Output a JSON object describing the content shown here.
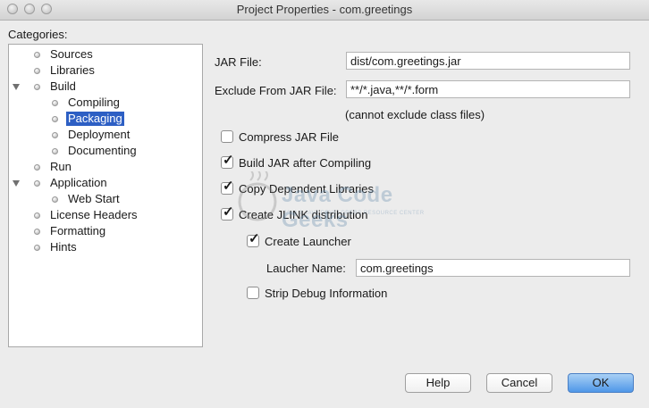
{
  "window": {
    "title": "Project Properties - com.greetings"
  },
  "categories": {
    "label": "Categories:",
    "items": [
      {
        "label": "Sources"
      },
      {
        "label": "Libraries"
      },
      {
        "label": "Build"
      },
      {
        "label": "Compiling"
      },
      {
        "label": "Packaging",
        "selected": true
      },
      {
        "label": "Deployment"
      },
      {
        "label": "Documenting"
      },
      {
        "label": "Run"
      },
      {
        "label": "Application"
      },
      {
        "label": "Web Start"
      },
      {
        "label": "License Headers"
      },
      {
        "label": "Formatting"
      },
      {
        "label": "Hints"
      }
    ]
  },
  "form": {
    "jar_file_label": "JAR File:",
    "jar_file_value": "dist/com.greetings.jar",
    "exclude_label": "Exclude From JAR File:",
    "exclude_value": "**/*.java,**/*.form",
    "exclude_note": "(cannot exclude class files)",
    "compress_label": "Compress JAR File",
    "compress_checked": false,
    "build_after_label": "Build JAR after Compiling",
    "build_after_checked": true,
    "copy_libs_label": "Copy Dependent Libraries",
    "copy_libs_checked": true,
    "jlink_label": "Create JLINK distribution",
    "jlink_checked": true,
    "launcher_label": "Create Launcher",
    "launcher_checked": true,
    "launcher_name_label": "Laucher Name:",
    "launcher_name_value": "com.greetings",
    "strip_debug_label": "Strip Debug Information",
    "strip_debug_checked": false
  },
  "watermark": {
    "text": "Java Code Geeks",
    "sub": "JAVA 2 JAVA DEVELOPERS RESOURCE CENTER"
  },
  "buttons": {
    "help": "Help",
    "cancel": "Cancel",
    "ok": "OK"
  }
}
